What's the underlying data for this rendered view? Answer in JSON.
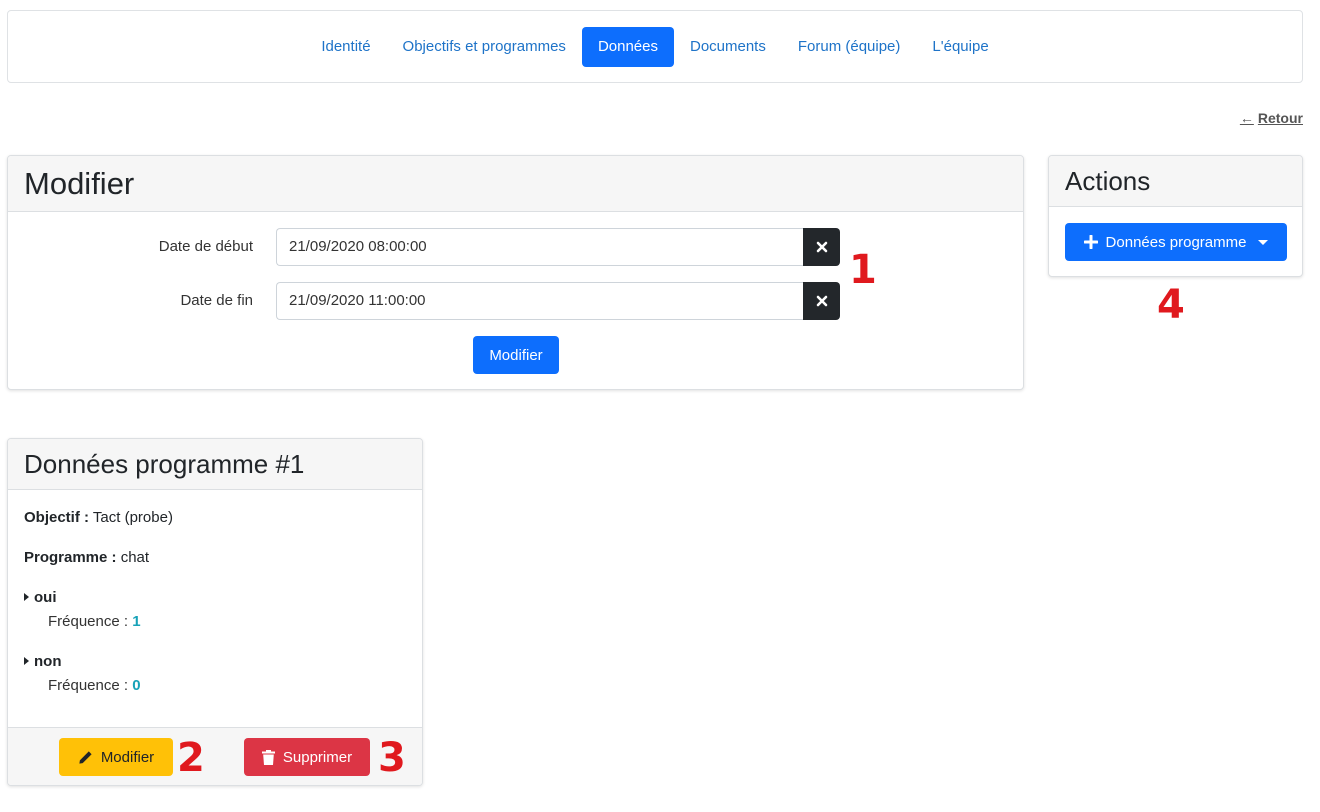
{
  "nav": {
    "tabs": [
      {
        "label": "Identité",
        "active": false
      },
      {
        "label": "Objectifs et programmes",
        "active": false
      },
      {
        "label": "Données",
        "active": true
      },
      {
        "label": "Documents",
        "active": false
      },
      {
        "label": "Forum (équipe)",
        "active": false
      },
      {
        "label": "L'équipe",
        "active": false
      }
    ]
  },
  "back": {
    "label": "Retour",
    "arrow": "←"
  },
  "modifier_card": {
    "title": "Modifier",
    "start_label": "Date de début",
    "start_value": "21/09/2020 08:00:00",
    "end_label": "Date de fin",
    "end_value": "21/09/2020 11:00:00",
    "submit_label": "Modifier"
  },
  "actions_card": {
    "title": "Actions",
    "add_label": "Données programme"
  },
  "programme_card": {
    "title": "Données programme #1",
    "objectif_label": "Objectif :",
    "objectif_value": "Tact (probe)",
    "programme_label": "Programme :",
    "programme_value": "chat",
    "answers": [
      {
        "label": "oui",
        "freq_label": "Fréquence :",
        "freq_value": "1"
      },
      {
        "label": "non",
        "freq_label": "Fréquence :",
        "freq_value": "0"
      }
    ],
    "edit_label": "Modifier",
    "delete_label": "Supprimer"
  },
  "markers": [
    "1",
    "2",
    "3",
    "4"
  ],
  "colors": {
    "primary": "#0d6efd",
    "warning": "#ffc107",
    "danger": "#dc3545",
    "dark": "#23272b",
    "info": "#17a2b8",
    "marker": "#e0191e",
    "link": "#1e73c8"
  }
}
